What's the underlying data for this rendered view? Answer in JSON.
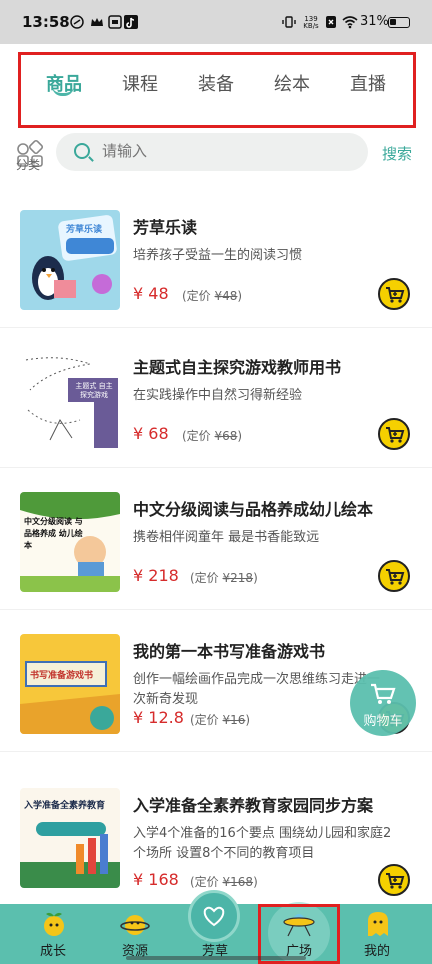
{
  "status_bar": {
    "time": "13:58",
    "net_speed_value": "139",
    "net_speed_unit": "KB/s",
    "battery": "31%"
  },
  "tabs": [
    {
      "label": "商品",
      "active": true
    },
    {
      "label": "课程",
      "active": false
    },
    {
      "label": "装备",
      "active": false
    },
    {
      "label": "绘本",
      "active": false
    },
    {
      "label": "直播",
      "active": false
    }
  ],
  "search": {
    "category_label": "分类",
    "placeholder": "请输入",
    "button_label": "搜索"
  },
  "products": [
    {
      "title": "芳草乐读",
      "desc": "培养孩子受益一生的阅读习惯",
      "price": "¥ 48",
      "orig_prefix": "(定价",
      "orig_price": "¥48",
      "orig_suffix": ")",
      "thumb_text": "芳草乐读"
    },
    {
      "title": "主题式自主探究游戏教师用书",
      "desc": "在实践操作中自然习得新经验",
      "price": "¥ 68",
      "orig_prefix": "(定价",
      "orig_price": "¥68",
      "orig_suffix": ")",
      "thumb_text": "主题式 自主探究游戏"
    },
    {
      "title": "中文分级阅读与品格养成幼儿绘本",
      "desc": "携卷相伴阅童年  最是书香能致远",
      "price": "¥ 218",
      "orig_prefix": "(定价",
      "orig_price": "¥218",
      "orig_suffix": ")",
      "thumb_text": "中文分级阅读 与品格养成 幼儿绘本"
    },
    {
      "title": "我的第一本书写准备游戏书",
      "desc": "创作一幅绘画作品完成一次思维练习走进一次新奇发现",
      "price": "¥ 12.8",
      "orig_prefix": "(定价",
      "orig_price": "¥16",
      "orig_suffix": ")",
      "thumb_text": "书写准备游戏书"
    },
    {
      "title": "入学准备全素养教育家园同步方案",
      "desc": "入学4个准备的16个要点 围绕幼儿园和家庭2个场所 设置8个不同的教育项目",
      "price": "¥ 168",
      "orig_prefix": "(定价",
      "orig_price": "¥168",
      "orig_suffix": ")",
      "thumb_text": "入学准备全素养教育"
    }
  ],
  "float_cart": {
    "label": "购物车"
  },
  "bottom_nav": [
    {
      "label": "成长"
    },
    {
      "label": "资源"
    },
    {
      "label": "芳草"
    },
    {
      "label": "广场"
    },
    {
      "label": "我的"
    }
  ],
  "colors": {
    "accent": "#3aa89a",
    "nav_bg": "#5bbfae",
    "price": "#d62b2b",
    "cart": "#f5d000",
    "highlight": "#e02020"
  }
}
